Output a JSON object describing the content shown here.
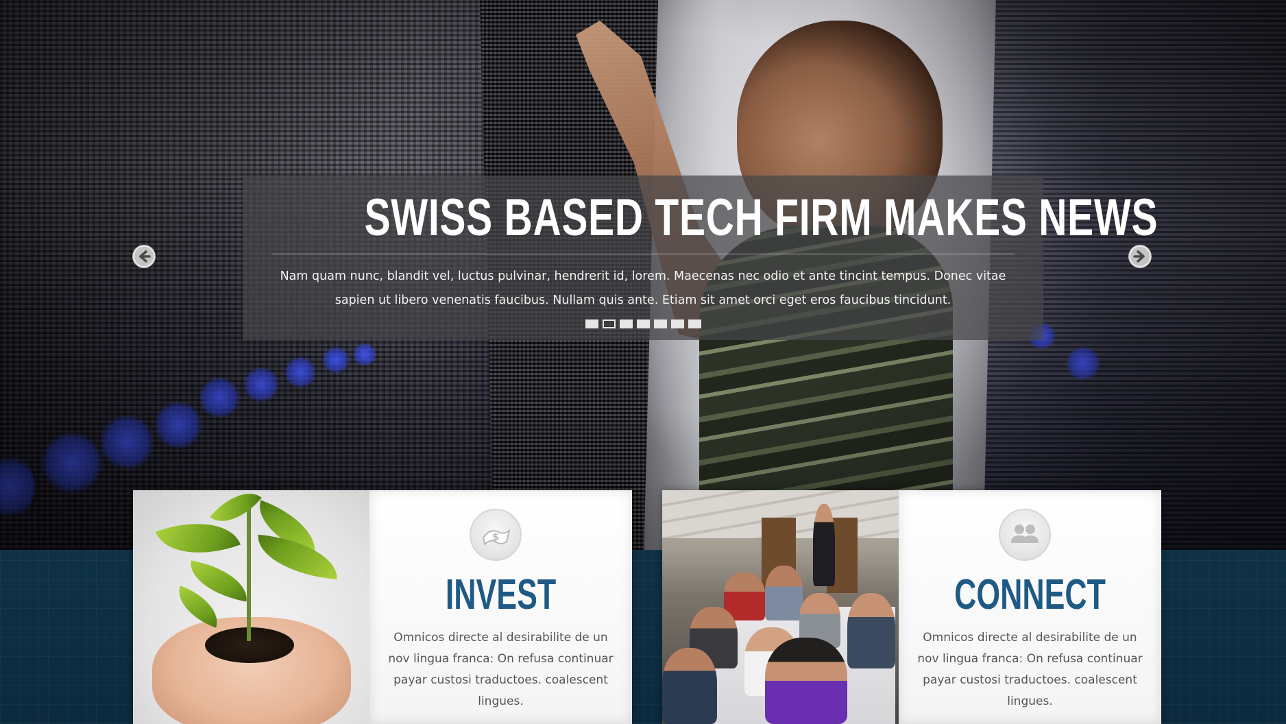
{
  "hero": {
    "title": "SWISS BASED TECH FIRM MAKES NEWS",
    "text": "Nam quam nunc, blandit vel, luctus pulvinar, hendrerit id, lorem. Maecenas nec odio et ante tincint tempus. Donec vitae sapien ut libero venenatis faucibus. Nullam quis ante. Etiam sit amet orci eget eros faucibus tincidunt.",
    "slides_count": 7,
    "active_slide": 2,
    "prev_icon": "arrow-left-icon",
    "next_icon": "arrow-right-icon"
  },
  "features": [
    {
      "title": "INVEST",
      "icon": "money-flag-icon",
      "text": "Omnicos directe al desirabilite de un nov lingua franca: On refusa continuar payar custosi traductoes. coalescent lingues.",
      "image": "seedling-in-hands"
    },
    {
      "title": "CONNECT",
      "icon": "people-icon",
      "text": "Omnicos directe al desirabilite de un nov lingua franca: On refusa continuar payar custosi traductoes. coalescent lingues.",
      "image": "meeting-room"
    }
  ],
  "colors": {
    "accent_title": "#1f5a85",
    "band": "#0d2a3c",
    "caption_bg": "#46464a"
  }
}
